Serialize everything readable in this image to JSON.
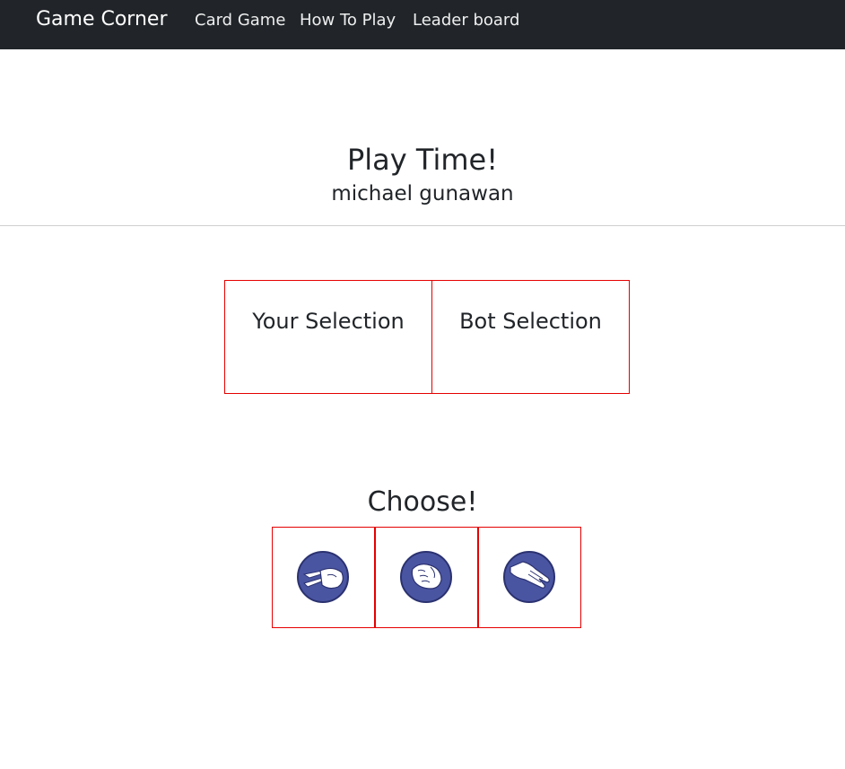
{
  "navbar": {
    "brand": "Game Corner",
    "links": [
      "Card Game",
      "How To Play",
      "Leader board"
    ]
  },
  "header": {
    "title": "Play Time!",
    "player_name": "michael gunawan"
  },
  "selection": {
    "your_label": "Your Selection",
    "bot_label": "Bot Selection"
  },
  "choices": {
    "heading": "Choose!",
    "options": [
      {
        "icon": "scissors-hand-icon"
      },
      {
        "icon": "rock-fist-icon"
      },
      {
        "icon": "paper-hand-icon"
      }
    ]
  },
  "colors": {
    "navbar_bg": "#212529",
    "box_border": "#e60000",
    "icon_fill": "#4a55a2"
  }
}
